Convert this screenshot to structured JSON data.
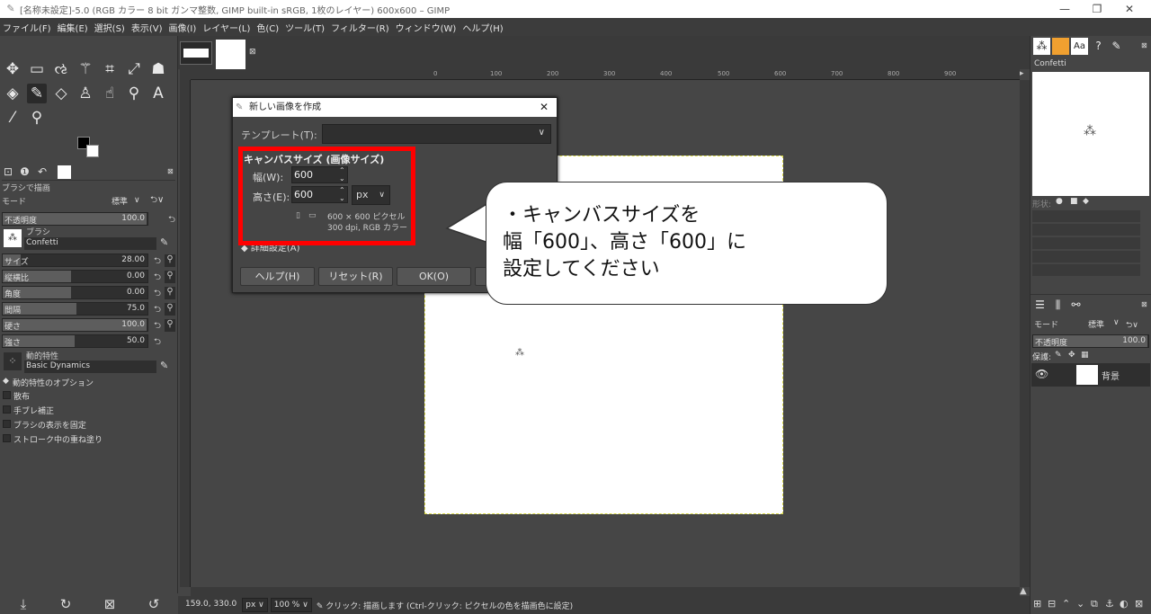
{
  "window": {
    "title": "[名称未設定]-5.0 (RGB カラー 8 bit ガンマ整数, GIMP built-in sRGB, 1枚のレイヤー) 600x600 – GIMP",
    "minimize": "—",
    "maximize": "❐",
    "close": "✕"
  },
  "menu": [
    "ファイル(F)",
    "編集(E)",
    "選択(S)",
    "表示(V)",
    "画像(I)",
    "レイヤー(L)",
    "色(C)",
    "ツール(T)",
    "フィルター(R)",
    "ウィンドウ(W)",
    "ヘルプ(H)"
  ],
  "tool_options": {
    "header": "ブラシで描画",
    "mode_label": "モード",
    "mode_value": "標準",
    "opacity_label": "不透明度",
    "opacity_value": "100.0",
    "brush_label": "ブラシ",
    "brush_value": "Confetti",
    "size_label": "サイズ",
    "size_value": "28.00",
    "aspect_label": "縦横比",
    "aspect_value": "0.00",
    "angle_label": "角度",
    "angle_value": "0.00",
    "spacing_label": "間隔",
    "spacing_value": "75.0",
    "hardness_label": "硬さ",
    "hardness_value": "100.0",
    "force_label": "強さ",
    "force_value": "50.0",
    "dynamics_label": "動的特性",
    "dynamics_value": "Basic Dynamics",
    "dynamics_options": "動的特性のオプション",
    "scatter": "散布",
    "smooth": "手ブレ補正",
    "lock_brush": "ブラシの表示を固定",
    "incremental": "ストローク中の重ね塗り"
  },
  "ruler_ticks": [
    "0",
    "100",
    "200",
    "300",
    "400",
    "500",
    "600",
    "700",
    "800",
    "900"
  ],
  "dialog": {
    "title": "新しい画像を作成",
    "template_label": "テンプレート(T):",
    "template_value": "",
    "canvas_size_label": "キャンバスサイズ (画像サイズ)",
    "width_label": "幅(W):",
    "width_value": "600",
    "height_label": "高さ(E):",
    "height_value": "600",
    "unit": "px",
    "info_line1": "600 × 600 ピクセル",
    "info_line2": "300 dpi, RGB カラー",
    "advanced_label": "詳細設定(A)",
    "help_button": "ヘルプ(H)",
    "reset_button": "リセット(R)",
    "ok_button": "OK(O)",
    "cancel_button": "キ"
  },
  "callout": {
    "line1": "・キャンバスサイズを",
    "line2": "幅「600」、高さ「600」に",
    "line3": "設定してください"
  },
  "right_panel": {
    "brush_name": "Confetti",
    "shape_label": "形状:",
    "layers_mode_label": "モード",
    "layers_mode_value": "標準",
    "layers_opacity_label": "不透明度",
    "layers_opacity_value": "100.0",
    "lock_label": "保護:",
    "layer_name": "背景"
  },
  "status": {
    "coords": "159.0, 330.0",
    "unit": "px",
    "zoom": "100 %",
    "message": "クリック: 描画します (Ctrl-クリック: ピクセルの色を描画色に設定)"
  }
}
